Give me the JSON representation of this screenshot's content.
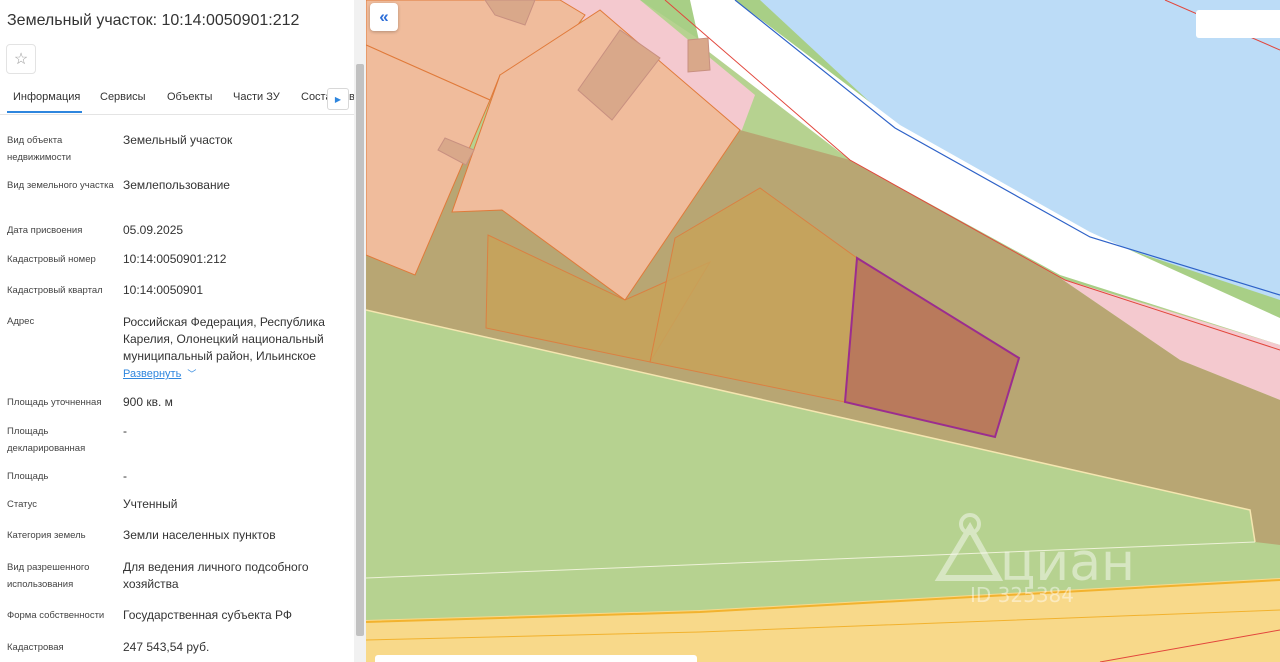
{
  "panel": {
    "title": "Земельный участок: 10:14:0050901:212",
    "tabs": [
      "Информация",
      "Сервисы",
      "Объекты",
      "Части ЗУ",
      "Соста"
    ],
    "tab_partial_tail": "в",
    "active_tab": "Информация",
    "rows": [
      {
        "label": "Вид объекта недвижимости",
        "value": "Земельный участок"
      },
      {
        "label": "Вид земельного участка",
        "value": "Землепользование"
      },
      {
        "label": "Дата присвоения",
        "value": "05.09.2025"
      },
      {
        "label": "Кадастровый номер",
        "value": "10:14:0050901:212"
      },
      {
        "label": "Кадастровый квартал",
        "value": "10:14:0050901"
      },
      {
        "label": "Адрес",
        "value": "Российская Федерация, Республика Карелия, Олонецкий национальный муниципальный район, Ильинское"
      },
      {
        "label": "Площадь уточненная",
        "value": "900 кв. м"
      },
      {
        "label": "Площадь декларированная",
        "value": "-"
      },
      {
        "label": "Площадь",
        "value": "-"
      },
      {
        "label": "Статус",
        "value": "Учтенный"
      },
      {
        "label": "Категория земель",
        "value": "Земли населенных пунктов"
      },
      {
        "label": "Вид разрешенного использования",
        "value": "Для ведения личного подсобного хозяйства"
      },
      {
        "label": "Форма собственности",
        "value": "Государственная субъекта РФ"
      },
      {
        "label": "Кадастровая",
        "value": "247 543,54 руб."
      }
    ],
    "expand_label": "Развернуть"
  },
  "map": {
    "watermark_brand": "циан",
    "watermark_id": "ID 325384",
    "colors": {
      "water": "#bcdcf7",
      "meadow": "#b6d290",
      "parcel_fill": "#b8a673",
      "building_parcel": "#f0bc9c",
      "road": "#f8d98a",
      "selected": "#b97a5c",
      "selected_border": "#9b2d8f"
    }
  },
  "icons": {
    "favorite": "star-icon",
    "tabs_next": "chevron-right-icon",
    "expand": "chevron-down-icon",
    "collapse_panel": "double-chevron-left-icon"
  }
}
